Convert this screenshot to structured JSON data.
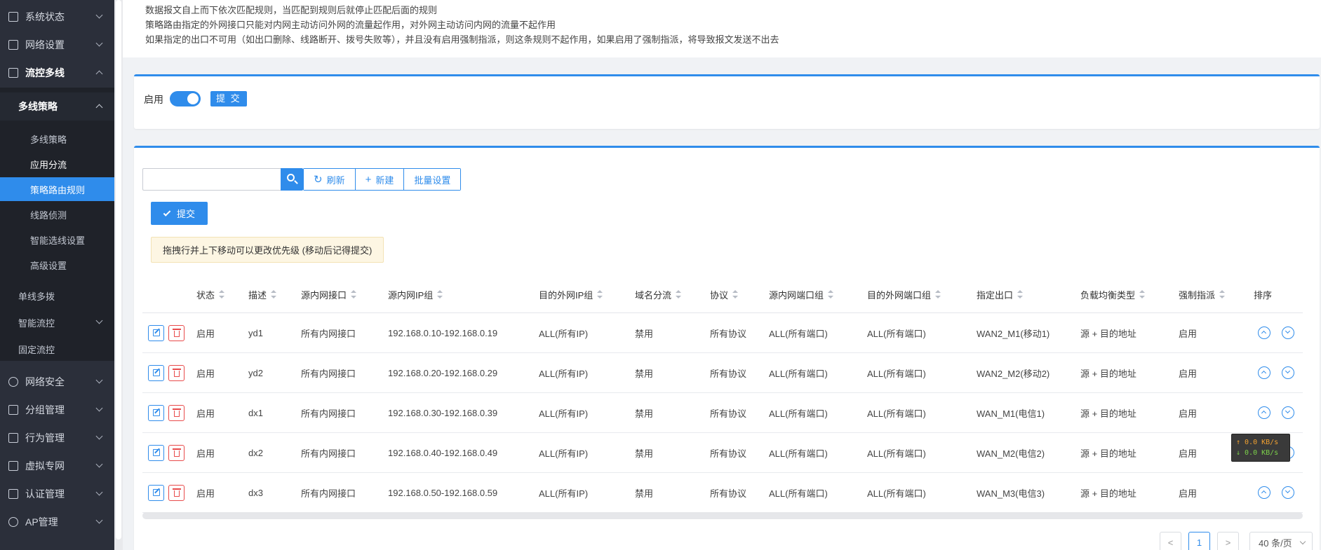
{
  "sidebar": {
    "top_items": [
      {
        "label": "系统状态",
        "icon": "chart-icon"
      },
      {
        "label": "网络设置",
        "icon": "network-icon"
      },
      {
        "label": "流控多线",
        "icon": "flow-icon"
      }
    ],
    "submenu_title": "多线策略",
    "leaves": [
      "多线策略",
      "应用分流",
      "策略路由规则",
      "线路侦测",
      "智能选线设置",
      "高级设置"
    ],
    "active_leaf": "策略路由规则",
    "plain_items": [
      "单线多拨",
      "智能流控",
      "固定流控"
    ],
    "bottom_items": [
      {
        "label": "网络安全",
        "icon": "globe-icon"
      },
      {
        "label": "分组管理",
        "icon": "list-icon"
      },
      {
        "label": "行为管理",
        "icon": "chart-up-icon"
      },
      {
        "label": "虚拟专网",
        "icon": "vpn-icon"
      },
      {
        "label": "认证管理",
        "icon": "user-icon"
      },
      {
        "label": "AP管理",
        "icon": "wifi-icon"
      }
    ]
  },
  "notes": [
    "数据报文自上而下依次匹配规则，当匹配到规则后就停止匹配后面的规则",
    "策略路由指定的外网接口只能对内网主动访问外网的流量起作用，对外网主动访问内网的流量不起作用",
    "如果指定的出口不可用（如出口删除、线路断开、拨号失败等），并且没有启用强制指派，则这条规则不起作用，如果启用了强制指派，将导致报文发送不出去"
  ],
  "enable_panel": {
    "label": "启用",
    "enabled": true,
    "submit": "提 交"
  },
  "toolbar": {
    "search_value": "",
    "refresh": "刷新",
    "create": "新建",
    "batch": "批量设置",
    "submit": "提交"
  },
  "tip": "拖拽行并上下移动可以更改优先级 (移动后记得提交)",
  "table": {
    "columns": [
      "状态",
      "描述",
      "源内网接口",
      "源内网IP组",
      "目的外网IP组",
      "域名分流",
      "协议",
      "源内网端口组",
      "目的外网端口组",
      "指定出口",
      "负载均衡类型",
      "强制指派",
      "排序"
    ],
    "rows": [
      [
        "启用",
        "yd1",
        "所有内网接口",
        "192.168.0.10-192.168.0.19",
        "ALL(所有IP)",
        "禁用",
        "所有协议",
        "ALL(所有端口)",
        "ALL(所有端口)",
        "WAN2_M1(移动1)",
        "源 + 目的地址",
        "启用"
      ],
      [
        "启用",
        "yd2",
        "所有内网接口",
        "192.168.0.20-192.168.0.29",
        "ALL(所有IP)",
        "禁用",
        "所有协议",
        "ALL(所有端口)",
        "ALL(所有端口)",
        "WAN2_M2(移动2)",
        "源 + 目的地址",
        "启用"
      ],
      [
        "启用",
        "dx1",
        "所有内网接口",
        "192.168.0.30-192.168.0.39",
        "ALL(所有IP)",
        "禁用",
        "所有协议",
        "ALL(所有端口)",
        "ALL(所有端口)",
        "WAN_M1(电信1)",
        "源 + 目的地址",
        "启用"
      ],
      [
        "启用",
        "dx2",
        "所有内网接口",
        "192.168.0.40-192.168.0.49",
        "ALL(所有IP)",
        "禁用",
        "所有协议",
        "ALL(所有端口)",
        "ALL(所有端口)",
        "WAN_M2(电信2)",
        "源 + 目的地址",
        "启用"
      ],
      [
        "启用",
        "dx3",
        "所有内网接口",
        "192.168.0.50-192.168.0.59",
        "ALL(所有IP)",
        "禁用",
        "所有协议",
        "ALL(所有端口)",
        "ALL(所有端口)",
        "WAN_M3(电信3)",
        "源 + 目的地址",
        "启用"
      ]
    ]
  },
  "pagination": {
    "prev": "<",
    "page": "1",
    "next": ">",
    "page_size": "40 条/页"
  },
  "speed": {
    "up": "↑ 0.0 KB/s",
    "down": "↓ 0.0 KB/s"
  },
  "colors": {
    "accent": "#2f8ceb",
    "danger": "#e84a4a",
    "sidebar": "#2b2f3a"
  }
}
